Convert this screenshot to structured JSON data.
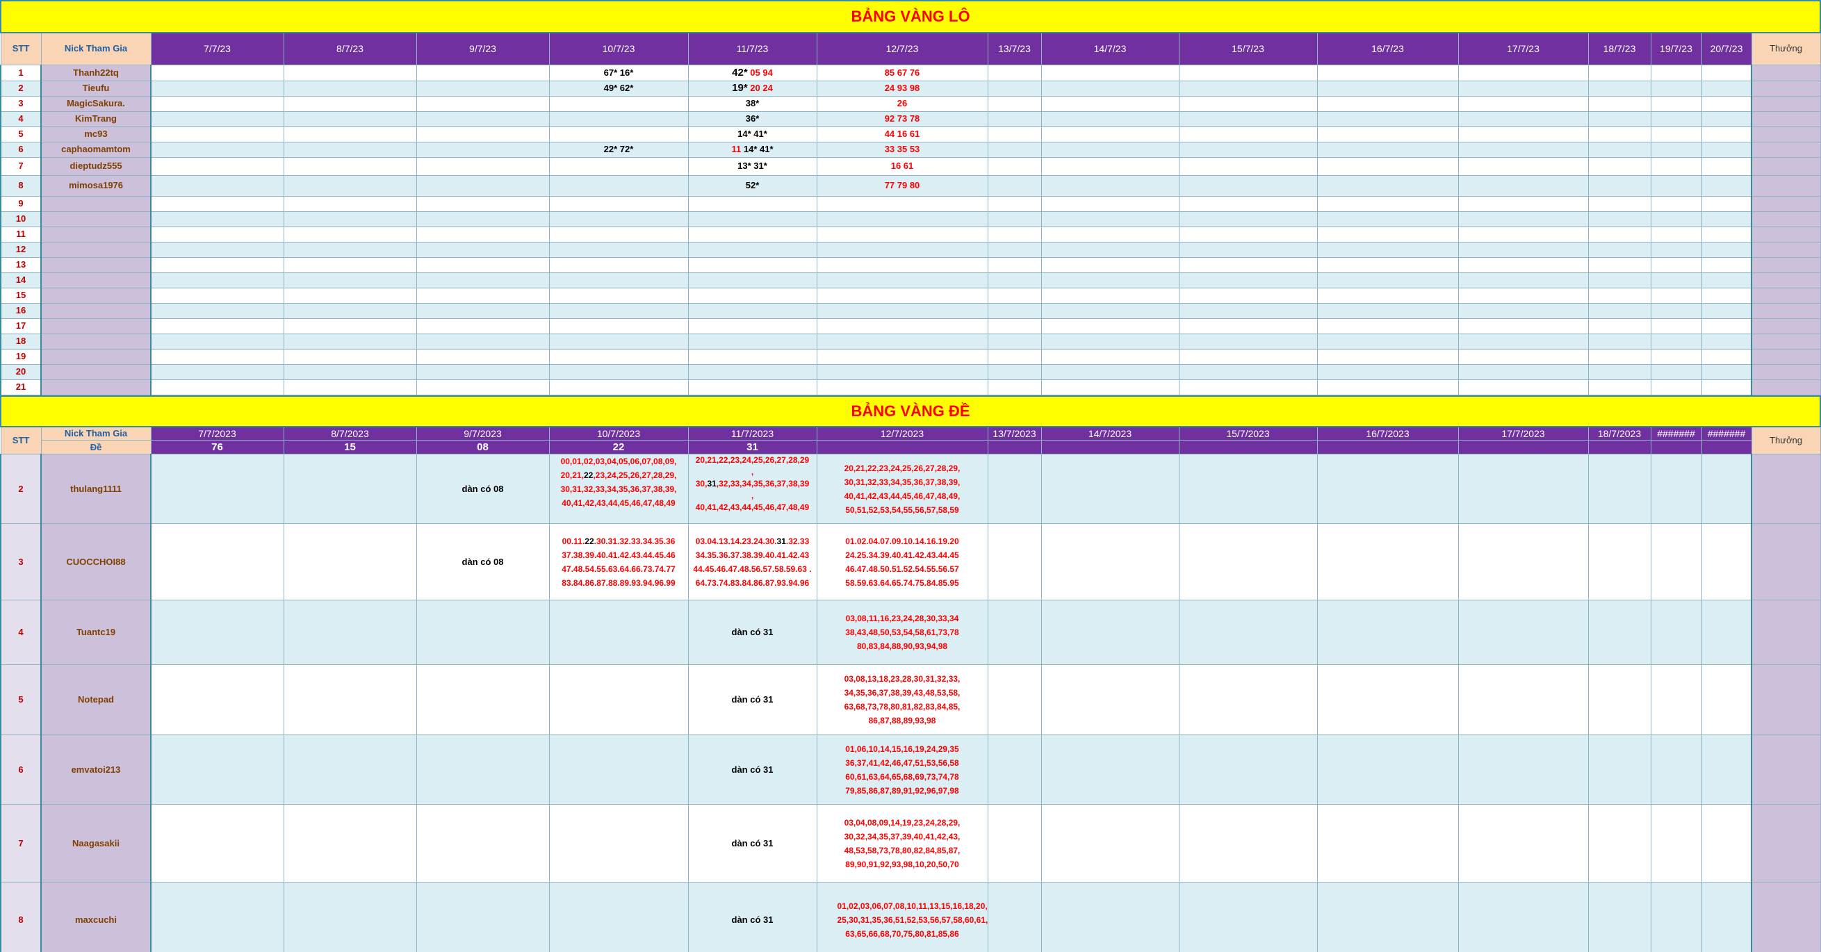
{
  "lo": {
    "title": "BẢNG VÀNG LÔ",
    "header": {
      "stt": "STT",
      "nick": "Nick Tham Gia",
      "prize": "Thưởng",
      "dates": [
        "7/7/23",
        "8/7/23",
        "9/7/23",
        "10/7/23",
        "11/7/23",
        "12/7/23",
        "13/7/23",
        "14/7/23",
        "15/7/23",
        "16/7/23",
        "17/7/23",
        "18/7/23",
        "19/7/23",
        "20/7/23"
      ]
    },
    "rows": [
      {
        "stt": "1",
        "nick": "Thanh22tq",
        "d10k": "67* 16*",
        "d11k": "42*",
        "d11r": "05 94",
        "d12r": "85 67 76"
      },
      {
        "stt": "2",
        "nick": "Tieufu",
        "d10k": "49* 62*",
        "d11k": "19*",
        "d11r": "20 24",
        "d12r": "24 93 98"
      },
      {
        "stt": "3",
        "nick": "MagicSakura.",
        "d10k": "",
        "d11k": "38*",
        "d11r": "",
        "d12r": "26"
      },
      {
        "stt": "4",
        "nick": "KimTrang",
        "d10k": "",
        "d11k": "36*",
        "d11r": "",
        "d12r": "92 73 78"
      },
      {
        "stt": "5",
        "nick": "mc93",
        "d10k": "",
        "d11k": "14* 41*",
        "d11r": "",
        "d12r": "44 16 61"
      },
      {
        "stt": "6",
        "nick": "caphaomamtom",
        "d10k": "22* 72*",
        "d11pre": "11",
        "d11k": "14* 41*",
        "d11r": "",
        "d12r": "33 35 53"
      },
      {
        "stt": "7",
        "nick": "dieptudz555",
        "d10k": "",
        "d11k": "13* 31*",
        "d11r": "",
        "d12r": "16 61"
      },
      {
        "stt": "8",
        "nick": "mimosa1976",
        "d10k": "",
        "d11k": "52*",
        "d11r": "",
        "d12r": "77 79 80"
      }
    ],
    "empty_stt": [
      "9",
      "10",
      "11",
      "12",
      "13",
      "14",
      "15",
      "16",
      "17",
      "18",
      "19",
      "20",
      "21"
    ]
  },
  "de": {
    "title": "BẢNG VÀNG ĐỀ",
    "header": {
      "stt": "STT",
      "nick": "Nick Tham Gia",
      "de_label": "Đề",
      "prize": "Thưởng",
      "dates": [
        "7/7/2023",
        "8/7/2023",
        "9/7/2023",
        "10/7/2023",
        "11/7/2023",
        "12/7/2023",
        "13/7/2023",
        "14/7/2023",
        "15/7/2023",
        "16/7/2023",
        "17/7/2023",
        "18/7/2023",
        "#######",
        "#######"
      ],
      "results": [
        "76",
        "15",
        "08",
        "22",
        "31",
        "",
        "",
        "",
        "",
        "",
        "",
        "",
        "",
        ""
      ]
    },
    "rows": [
      {
        "stt": "2",
        "nick": "thulang1111",
        "d9": "dàn có 08",
        "d10a": "00,01,02,03,04,05,06,07,08,09,",
        "d10b": "20,21,",
        "d10hl": "22",
        "d10c": ",23,24,25,26,27,28,29,",
        "d10d": "30,31,32,33,34,35,36,37,38,39,",
        "d10e": "40,41,42,43,44,45,46,47,48,49",
        "d11a": "20,21,22,23,24,25,26,27,28,29",
        "d11b": ",",
        "d11c": "30,",
        "d11hl": "31",
        "d11d": ",32,33,34,35,36,37,38,39",
        "d11e": ",",
        "d11f": "40,41,42,43,44,45,46,47,48,49",
        "d12": "20,21,22,23,24,25,26,27,28,29, 30,31,32,33,34,35,36,37,38,39, 40,41,42,43,44,45,46,47,48,49, 50,51,52,53,54,55,56,57,58,59"
      },
      {
        "stt": "3",
        "nick": "CUOCCHOI88",
        "d9": "dàn có 08",
        "d10a": "00.11.",
        "d10hl": "22",
        "d10b": ".30.31.32.33.34.35.36 37.38.39.40.41.42.43.44.45.46 47.48.54.55.63.64.66.73.74.77 83.84.86.87.88.89.93.94.96.99",
        "d11a": "03.04.13.14.23.24.30.",
        "d11hl": "31",
        "d11b": ".32.33 34.35.36.37.38.39.40.41.42.43 44.45.46.47.48.56.57.58.59.63 . 64.73.74.83.84.86.87.93.94.96",
        "d12": "01.02.04.07.09.10.14.16.19.20 24.25.34.39.40.41.42.43.44.45 46.47.48.50.51.52.54.55.56.57 58.59.63.64.65.74.75.84.85.95"
      },
      {
        "stt": "4",
        "nick": "Tuantc19",
        "d11": "dàn có 31",
        "d12": "03,08,11,16,23,24,28,30,33,34 38,43,48,50,53,54,58,61,73,78 80,83,84,88,90,93,94,98"
      },
      {
        "stt": "5",
        "nick": "Notepad",
        "d11": "dàn có 31",
        "d12": "03,08,13,18,23,28,30,31,32,33, 34,35,36,37,38,39,43,48,53,58, 63,68,73,78,80,81,82,83,84,85, 86,87,88,89,93,98"
      },
      {
        "stt": "6",
        "nick": "emvatoi213",
        "d11": "dàn có 31",
        "d12": "01,06,10,14,15,16,19,24,29,35 36,37,41,42,46,47,51,53,56,58 60,61,63,64,65,68,69,73,74,78 79,85,86,87,89,91,92,96,97,98"
      },
      {
        "stt": "7",
        "nick": "Naagasakii",
        "d11": "dàn có 31",
        "d12": "03,04,08,09,14,19,23,24,28,29, 30,32,34,35,37,39,40,41,42,43, 48,53,58,73,78,80,82,84,85,87, 89,90,91,92,93,98,10,20,50,70"
      },
      {
        "stt": "8",
        "nick": "maxcuchi",
        "d11": "dàn có 31",
        "d12": "01,02,03,06,07,08,10,11,13,15,16,18,20, 25,30,31,35,36,51,52,53,56,57,58,60,61, 63,65,66,68,70,75,80,81,85,86"
      }
    ]
  },
  "colors": {
    "title_bg": "#ffff00",
    "title_fg": "#ff0000",
    "header_purple": "#7030a0",
    "header_peach": "#f9d5b6",
    "nick_bg": "#ccc0da",
    "row_blue": "#daeef3",
    "red_text": "#ff0000"
  }
}
